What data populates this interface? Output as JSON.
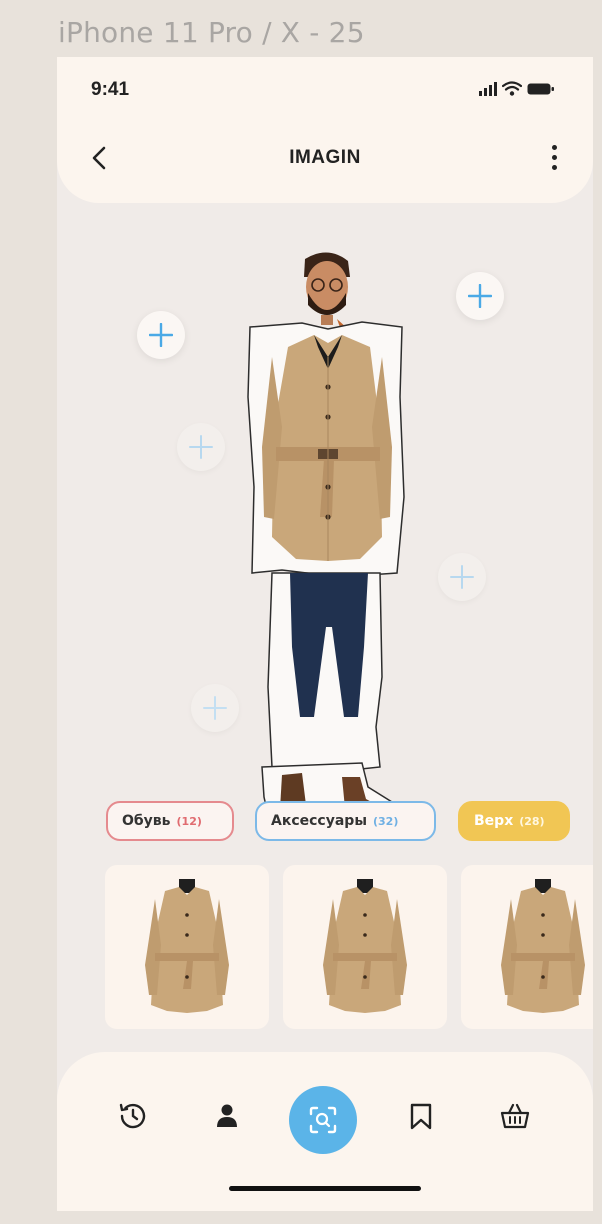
{
  "frame": {
    "label": "iPhone 11 Pro / X - 25"
  },
  "status_bar": {
    "time": "9:41"
  },
  "header": {
    "title": "IMAGIN"
  },
  "categories": [
    {
      "label": "Обувь",
      "count": "(12)",
      "color": "#e58a8e"
    },
    {
      "label": "Аксессуары",
      "count": "(32)",
      "color": "#7cb9e8"
    },
    {
      "label": "Верх",
      "count": "(28)",
      "color": "#f1c654"
    }
  ],
  "products": [
    {
      "icon": "trench-coat"
    },
    {
      "icon": "trench-coat"
    },
    {
      "icon": "trench-coat"
    }
  ],
  "bottom_nav": {
    "items": [
      "history-icon",
      "profile-icon",
      "scan-search-icon",
      "bookmark-icon",
      "basket-icon"
    ],
    "active": "scan-search-icon"
  },
  "colors": {
    "accent_blue": "#5bb4e8",
    "coat": "#c9a77a",
    "jeans": "#20314f",
    "background": "#f0ebe8"
  }
}
